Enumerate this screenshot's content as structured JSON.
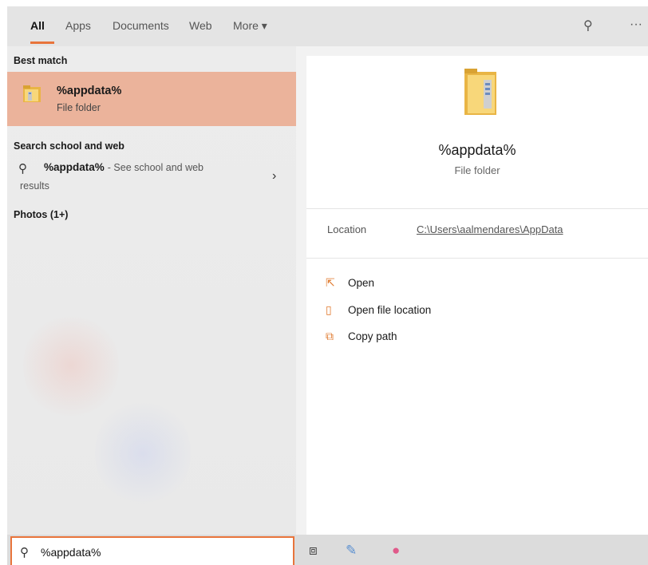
{
  "tabs": {
    "items": [
      {
        "label": "All"
      },
      {
        "label": "Apps"
      },
      {
        "label": "Documents"
      },
      {
        "label": "Web"
      },
      {
        "label": "More ▾"
      }
    ],
    "feedback_icon": "⚲",
    "more_options_icon": "···"
  },
  "left": {
    "best_match_heading": "Best match",
    "best_match": {
      "title": "%appdata%",
      "subtitle": "File folder"
    },
    "search_web_heading": "Search school and web",
    "web_result": {
      "title": "%appdata%",
      "suffix": "- See school and web",
      "subtitle": "results"
    },
    "photos_heading": "Photos (1+)"
  },
  "right": {
    "title": "%appdata%",
    "subtitle": "File folder",
    "location_label": "Location",
    "location_value": "C:\\Users\\aalmendares\\AppData",
    "actions": [
      {
        "label": "Open",
        "icon": "open-icon"
      },
      {
        "label": "Open file location",
        "icon": "open-file-location-icon"
      },
      {
        "label": "Copy path",
        "icon": "copy-path-icon"
      }
    ]
  },
  "search": {
    "value": "%appdata%"
  },
  "colors": {
    "accent": "#e8743b",
    "selected": "#ebb39b"
  }
}
